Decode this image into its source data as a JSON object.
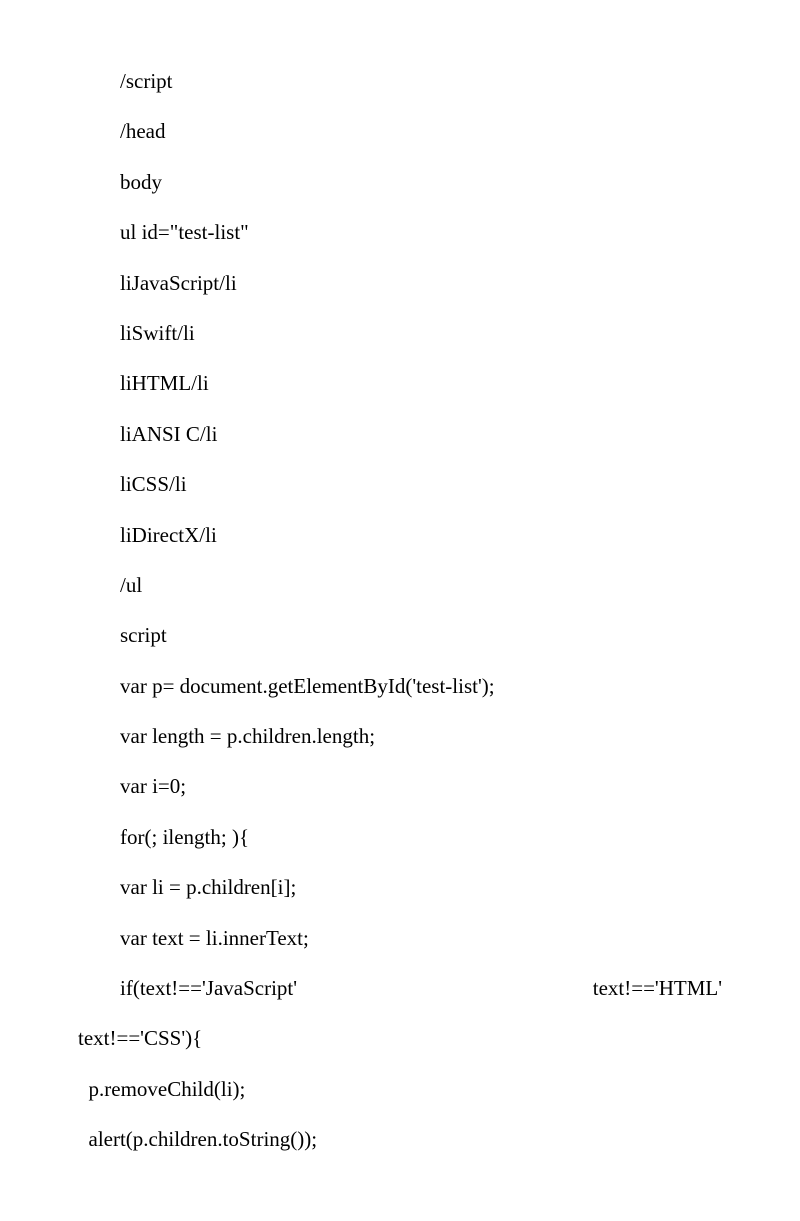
{
  "lines": [
    "/script",
    "/head",
    "body",
    "ul id=\"test-list\"",
    "liJavaScript/li",
    "liSwift/li",
    "liHTML/li",
    "liANSI C/li",
    "liCSS/li",
    "liDirectX/li",
    "/ul",
    "script",
    "var p= document.getElementById('test-list');",
    "var length = p.children.length;",
    "var i=0;",
    "for(; ilength; ){",
    "var li = p.children[i];",
    "var text = li.innerText;"
  ],
  "spread": {
    "left": "if(text!=='JavaScript'",
    "right": "text!=='HTML'"
  },
  "tail": [
    "text!=='CSS'){",
    "  p.removeChild(li);",
    "  alert(p.children.toString());"
  ]
}
